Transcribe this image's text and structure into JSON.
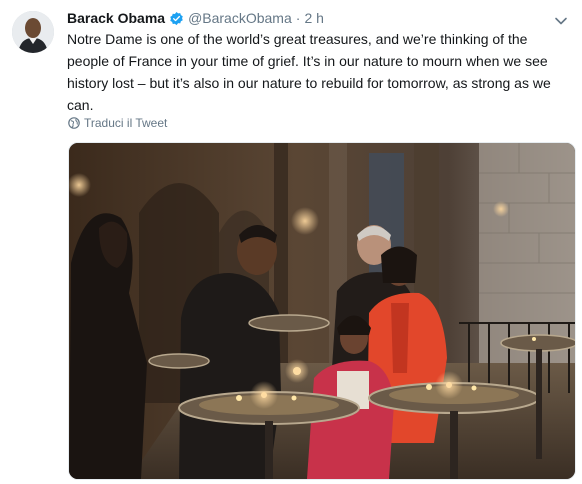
{
  "tweet": {
    "author_name": "Barack Obama",
    "handle": "@BarackObama",
    "separator": "·",
    "time": "2 h",
    "text": "Notre Dame is one of the world’s great treasures, and we’re thinking of the people of France in your time of grief. It’s in our nature to mourn when we see history lost – but it’s also in our nature to rebuild for tomorrow, as strong as we can.",
    "translate_label": "Traduci il Tweet"
  },
  "icons": {
    "verified": "verified-badge-icon",
    "caret": "chevron-down-icon",
    "translate": "globe-icon"
  },
  "colors": {
    "text": "#14171a",
    "secondary": "#657786",
    "verified": "#1da1f2"
  }
}
